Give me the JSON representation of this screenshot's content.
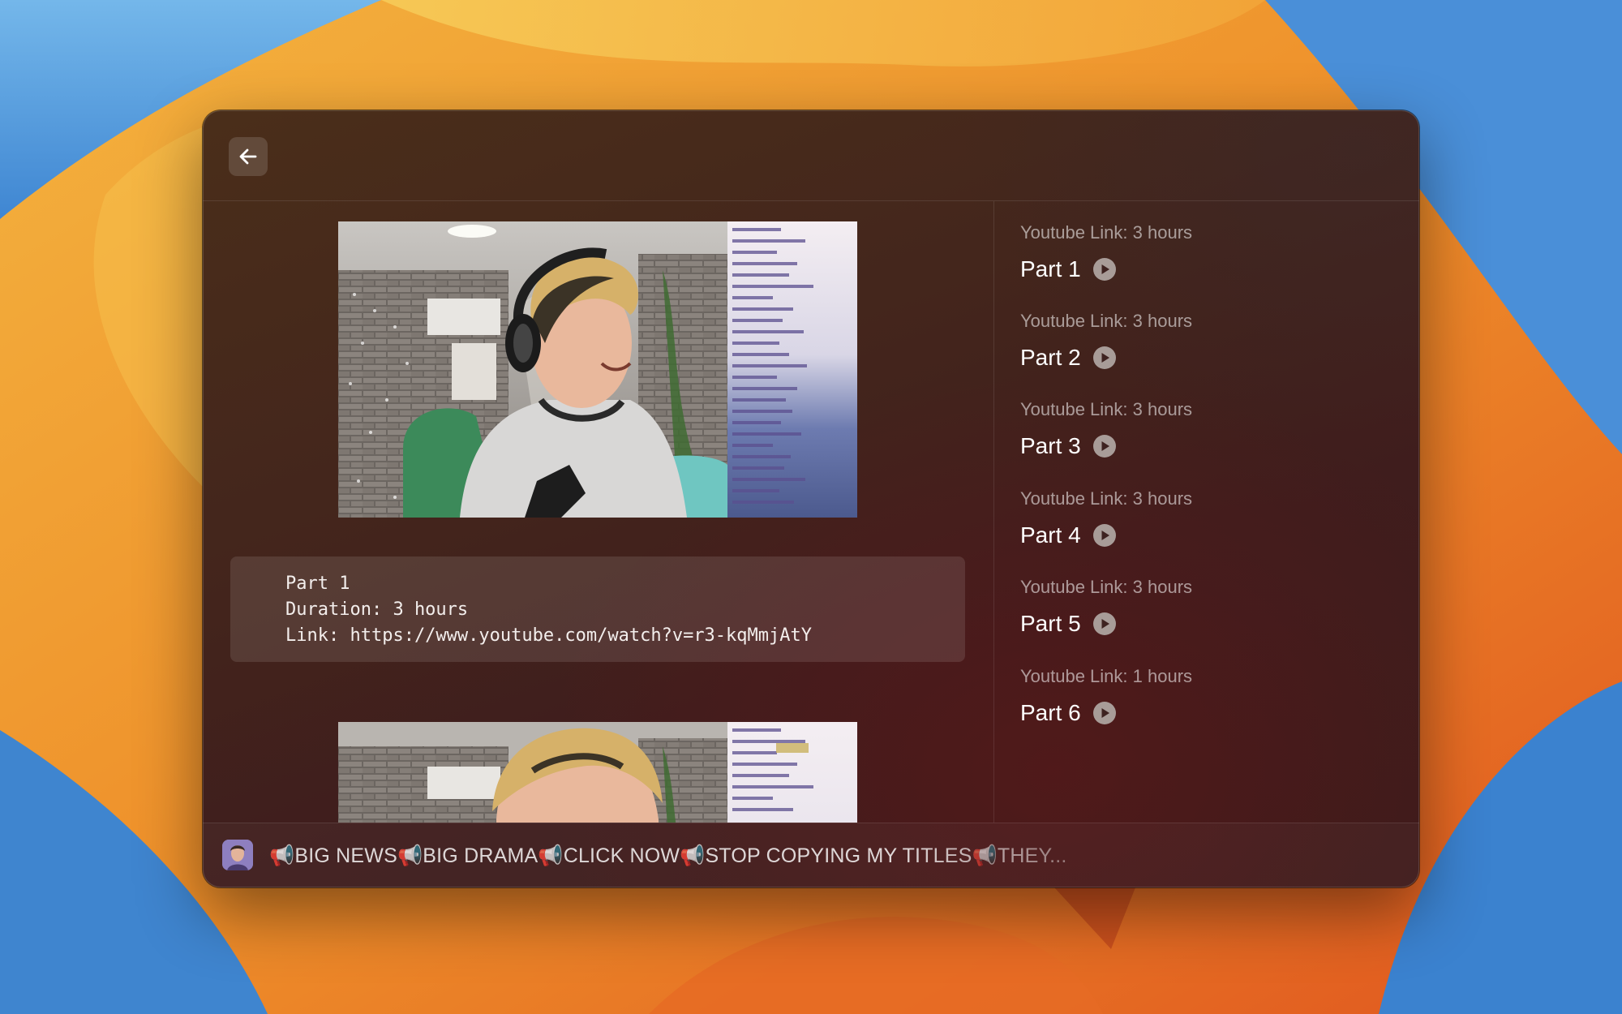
{
  "window": {
    "back_icon": "arrow-left-icon"
  },
  "detail": {
    "code_lines": [
      "Part 1",
      "Duration: 3 hours",
      "Link: https://www.youtube.com/watch?v=r3-kqMmjAtY"
    ]
  },
  "list": {
    "items": [
      {
        "subtitle": "Youtube Link: 3 hours",
        "title": "Part 1",
        "icon": "play-circle-icon"
      },
      {
        "subtitle": "Youtube Link: 3 hours",
        "title": "Part 2",
        "icon": "play-circle-icon"
      },
      {
        "subtitle": "Youtube Link: 3 hours",
        "title": "Part 3",
        "icon": "play-circle-icon"
      },
      {
        "subtitle": "Youtube Link: 3 hours",
        "title": "Part 4",
        "icon": "play-circle-icon"
      },
      {
        "subtitle": "Youtube Link: 3 hours",
        "title": "Part 5",
        "icon": "play-circle-icon"
      },
      {
        "subtitle": "Youtube Link: 1 hours",
        "title": "Part 6",
        "icon": "play-circle-icon"
      }
    ]
  },
  "footer": {
    "ticker_text": "📢BIG NEWS📢BIG DRAMA📢CLICK NOW📢STOP COPYING MY TITLES📢THEY..."
  },
  "colors": {
    "window_bg": "#44261c",
    "accent_text": "#ffffff",
    "muted_text": "#a99a93"
  }
}
